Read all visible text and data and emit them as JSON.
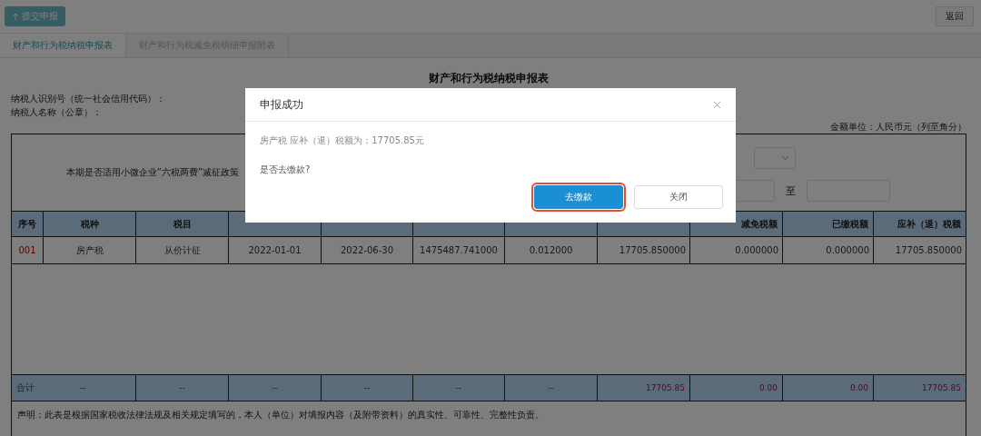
{
  "toolbar": {
    "submit_button": "提交申报",
    "back_button": "返回"
  },
  "tabs": [
    {
      "label": "财产和行为税纳税申报表",
      "selected": true
    },
    {
      "label": "财产和行为税减免税明细申报附表",
      "selected": false
    }
  ],
  "form": {
    "title": "财产和行为税纳税申报表",
    "taxpayer_id_label": "纳税人识别号（统一社会信用代码）：",
    "taxpayer_name_label": "纳税人名称（公章）：",
    "unit_label": "金额单位：人民币元（列至角分）",
    "policy_label": "本期是否适用小微企业“六税两费”减征政策",
    "date_separator": "至"
  },
  "table": {
    "columns": [
      "序号",
      "税种",
      "税目",
      null,
      null,
      null,
      null,
      null,
      "减免税额",
      "已缴税额",
      "应补（退）税额"
    ],
    "rows": [
      [
        "001",
        "房产税",
        "从价计征",
        "2022-01-01",
        "2022-06-30",
        "1475487.741000",
        "0.012000",
        "17705.850000",
        "0.000000",
        "0.000000",
        "17705.850000"
      ]
    ],
    "total": {
      "label": "合计",
      "cells": [
        "--",
        "--",
        "--",
        "--",
        "--",
        "--",
        "17705.85",
        "0.00",
        "0.00",
        "17705.85"
      ]
    }
  },
  "declaration": "声明：此表是根据国家税收法律法规及相关规定填写的，本人（单位）对填报内容（及附带资料）的真实性、可靠性、完整性负责。",
  "dialog": {
    "title": "申报成功",
    "message": "房产税 应补（退）税额为：17705.85元",
    "question": "是否去缴款?",
    "buttons": [
      {
        "label": "去缴款",
        "kind": "primary",
        "highlighted": true
      },
      {
        "label": "关闭",
        "kind": "secondary",
        "highlighted": false
      }
    ]
  }
}
